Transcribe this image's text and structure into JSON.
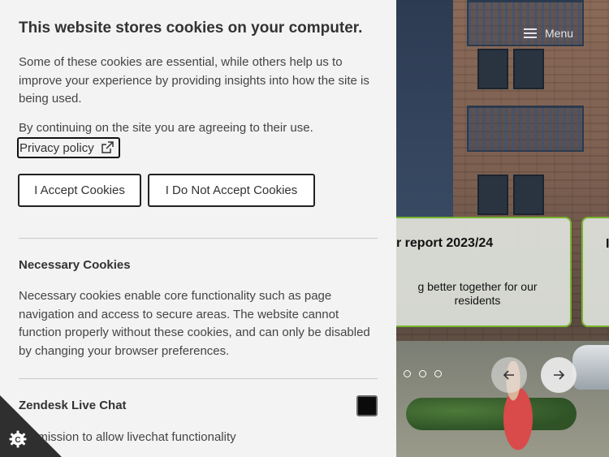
{
  "cookie_banner": {
    "title": "This website stores cookies on your computer.",
    "description": "Some of these cookies are essential, while others help us to improve your experience by providing insights into how the site is being used.",
    "agreement_text": "By continuing on the site you are agreeing to their use.",
    "privacy_link_label": "Privacy policy",
    "accept_button_label": "I Accept Cookies",
    "decline_button_label": "I Do Not Accept Cookies",
    "sections": [
      {
        "title": "Necessary Cookies",
        "body": "Necessary cookies enable core functionality such as page navigation and access to secure areas. The website cannot function properly without these cookies, and can only be disabled by changing your browser preferences."
      },
      {
        "title": "Zendesk Live Chat",
        "body": "Permission to allow livechat functionality",
        "toggle_state": "on"
      }
    ],
    "settings_icon": "cookie-settings-icon"
  },
  "site": {
    "menu_label": "Menu",
    "menu_icon": "hamburger-icon",
    "cards": [
      {
        "title": "r report 2023/24",
        "subtitle": "g better together for our residents"
      },
      {
        "title": "I t"
      }
    ],
    "carousel": {
      "dot_count": 3,
      "prev_icon": "arrow-left-icon",
      "next_icon": "arrow-right-icon"
    }
  },
  "colors": {
    "panel_background": "#f3f3f3",
    "card_border": "#78b32f",
    "toggle": "#0b0b0b"
  }
}
